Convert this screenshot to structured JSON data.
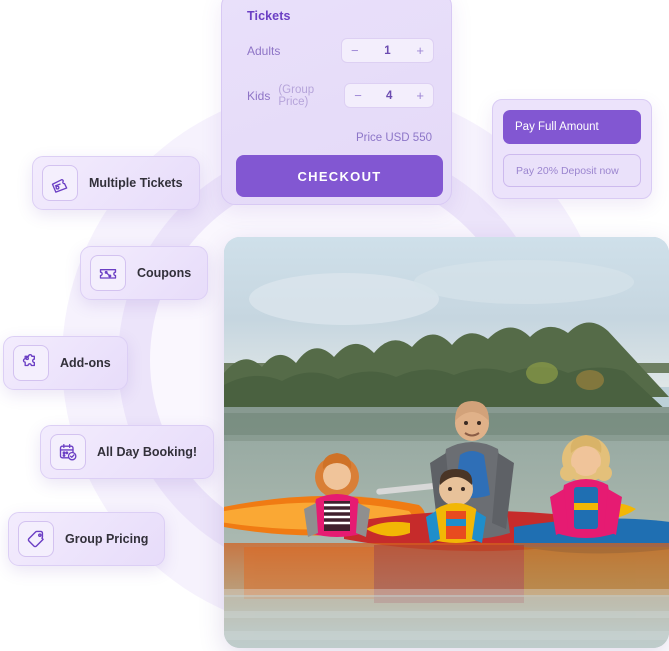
{
  "tickets_card": {
    "title": "Tickets",
    "rows": [
      {
        "label": "Adults",
        "sublabel": "",
        "value": "1",
        "minus": "−",
        "plus": "+"
      },
      {
        "label": "Kids",
        "sublabel": "(Group Price)",
        "value": "4",
        "minus": "−",
        "plus": "+"
      }
    ],
    "price_text": "Price USD 550",
    "checkout_label": "CHECKOUT"
  },
  "payment_card": {
    "full_label": "Pay Full Amount",
    "deposit_label": "Pay 20% Deposit now"
  },
  "features": [
    {
      "label": "Multiple Tickets",
      "icon": "tickets-icon"
    },
    {
      "label": "Coupons",
      "icon": "coupon-icon"
    },
    {
      "label": "Add-ons",
      "icon": "puzzle-piece-icon"
    },
    {
      "label": "All Day Booking!",
      "icon": "calendar-check-icon"
    },
    {
      "label": "Group Pricing",
      "icon": "price-tag-icon"
    }
  ],
  "photo": {
    "alt": "Family of four in kayaks on a calm lake with autumn trees behind"
  },
  "colors": {
    "accent": "#8257d2",
    "accent_deep": "#6b3fc4",
    "card_bg": "#e9e0fa",
    "chip_bg": "#f3ecfd",
    "circle_outer": "#f6f2fd",
    "circle_inner": "#ece4fa"
  }
}
